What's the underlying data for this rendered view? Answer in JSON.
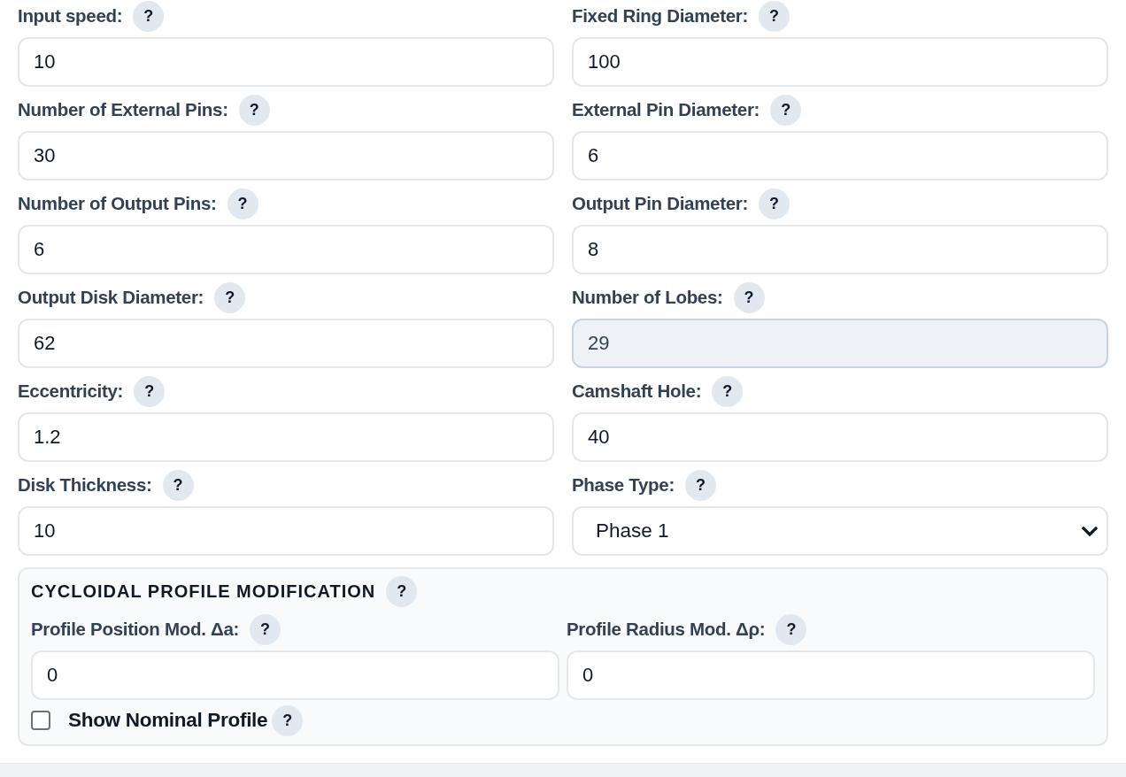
{
  "fields": [
    {
      "label": "Input speed:",
      "help": "?",
      "kind": "input",
      "value": "10",
      "disabled": false
    },
    {
      "label": "Fixed Ring Diameter:",
      "help": "?",
      "kind": "input",
      "value": "100",
      "disabled": false
    },
    {
      "label": "Number of External Pins:",
      "help": "?",
      "kind": "input",
      "value": "30",
      "disabled": false
    },
    {
      "label": "External Pin Diameter:",
      "help": "?",
      "kind": "input",
      "value": "6",
      "disabled": false
    },
    {
      "label": "Number of Output Pins:",
      "help": "?",
      "kind": "input",
      "value": "6",
      "disabled": false
    },
    {
      "label": "Output Pin Diameter:",
      "help": "?",
      "kind": "input",
      "value": "8",
      "disabled": false
    },
    {
      "label": "Output Disk Diameter:",
      "help": "?",
      "kind": "input",
      "value": "62",
      "disabled": false
    },
    {
      "label": "Number of Lobes:",
      "help": "?",
      "kind": "input",
      "value": "29",
      "disabled": true
    },
    {
      "label": "Eccentricity:",
      "help": "?",
      "kind": "input",
      "value": "1.2",
      "disabled": false
    },
    {
      "label": "Camshaft Hole:",
      "help": "?",
      "kind": "input",
      "value": "40",
      "disabled": false
    },
    {
      "label": "Disk Thickness:",
      "help": "?",
      "kind": "input",
      "value": "10",
      "disabled": false
    },
    {
      "label": "Phase Type:",
      "help": "?",
      "kind": "select",
      "value": "Phase 1",
      "disabled": false
    }
  ],
  "section": {
    "title": "CYCLOIDAL PROFILE MODIFICATION",
    "help": "?",
    "fields": [
      {
        "label": "Profile Position Mod. Δa:",
        "help": "?",
        "kind": "input",
        "value": "0",
        "disabled": false
      },
      {
        "label": "Profile Radius Mod. Δρ:",
        "help": "?",
        "kind": "input",
        "value": "0",
        "disabled": false
      }
    ],
    "checkbox": {
      "label": "Show Nominal Profile",
      "help": "?",
      "checked": false
    }
  }
}
